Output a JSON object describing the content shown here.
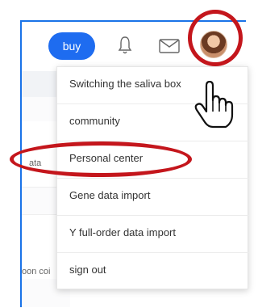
{
  "header": {
    "buy_label": "buy",
    "icons": [
      "bell-icon",
      "mail-icon"
    ]
  },
  "background": {
    "text_a": "ata",
    "text_b": "oon coi"
  },
  "menu": {
    "items": [
      {
        "label": "Switching the saliva box"
      },
      {
        "label": "community"
      },
      {
        "label": "Personal center"
      },
      {
        "label": "Gene data import"
      },
      {
        "label": "Y full-order data import"
      },
      {
        "label": "sign out"
      }
    ]
  },
  "colors": {
    "accent": "#1e6cf0",
    "annotation": "#c4161c",
    "frame": "#1a73e8"
  }
}
